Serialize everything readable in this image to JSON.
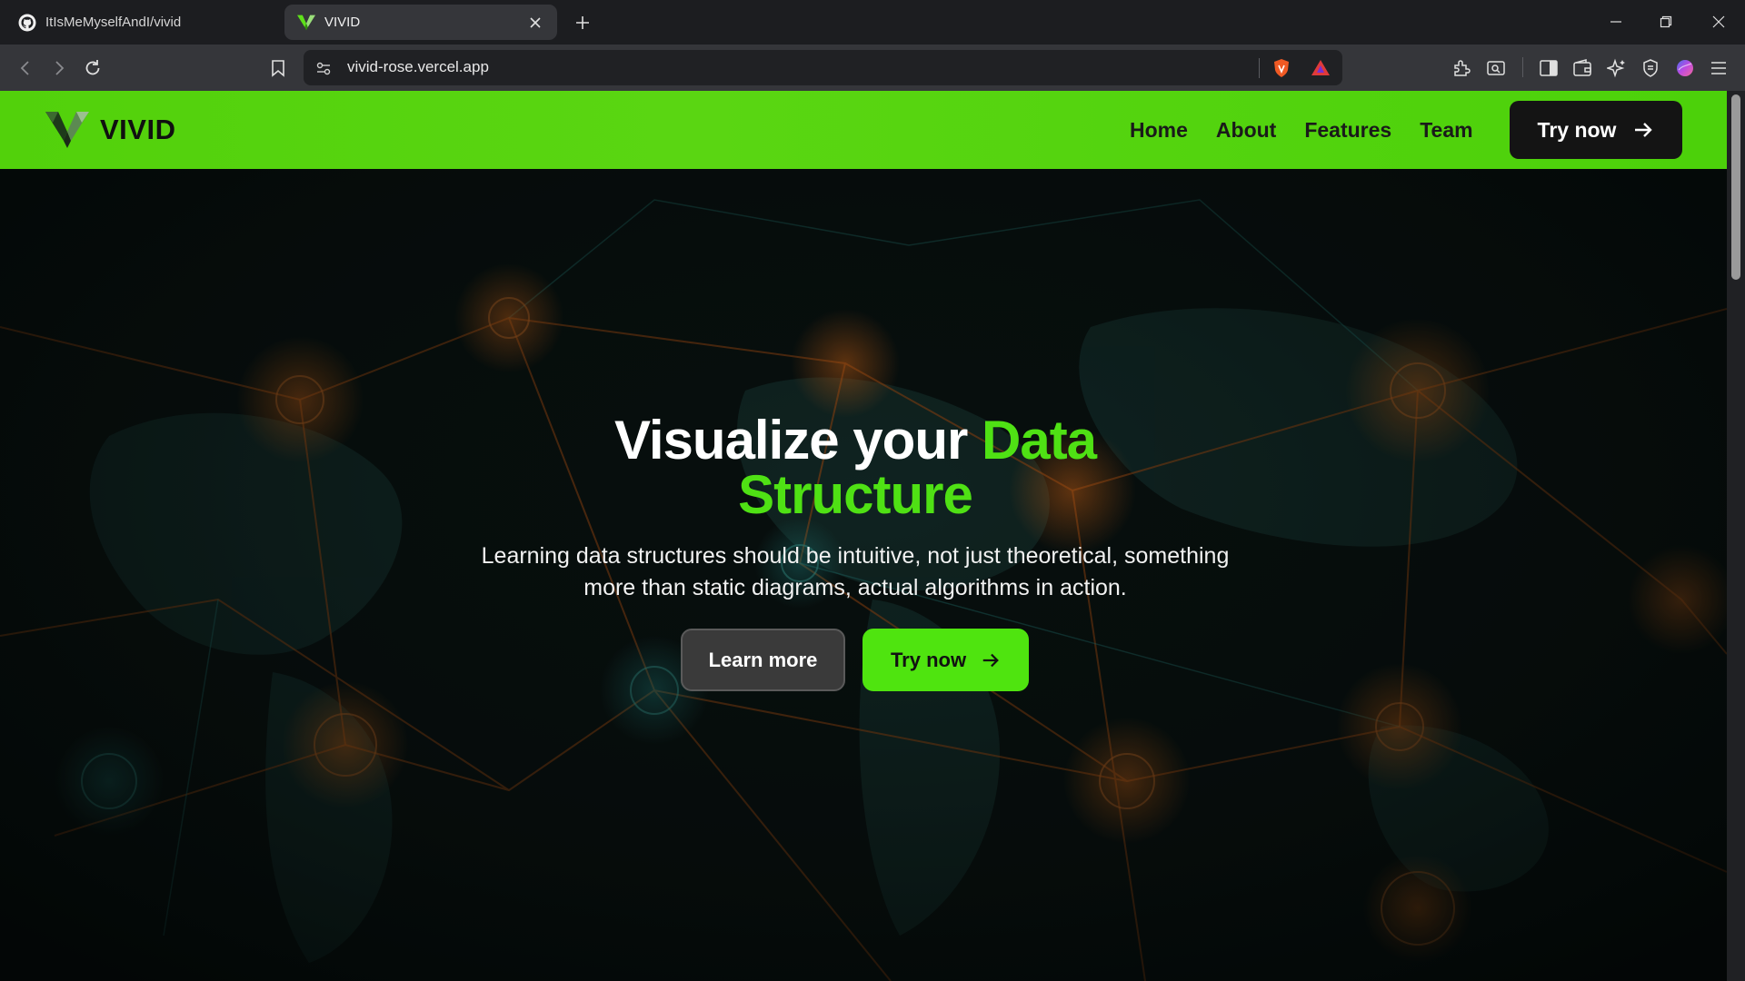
{
  "browser": {
    "tabs": [
      {
        "title": "ItIsMeMyselfAndI/vivid",
        "favicon": "github-icon",
        "active": false
      },
      {
        "title": "VIVID",
        "favicon": "vivid-logo-icon",
        "active": true
      }
    ],
    "address": "vivid-rose.vercel.app"
  },
  "site": {
    "brand": "VIVID",
    "nav": {
      "links": [
        "Home",
        "About",
        "Features",
        "Team"
      ],
      "cta_label": "Try now"
    },
    "hero": {
      "title_plain": "Visualize your ",
      "title_accent_1": "Data",
      "title_accent_2": "Structure",
      "subtitle": "Learning data structures should be intuitive, not just theoretical, something more than static diagrams, actual algorithms in action.",
      "learn_more_label": "Learn more",
      "try_now_label": "Try now"
    }
  },
  "colors": {
    "accent_green": "#4fe114",
    "nav_bar": "#52d10b",
    "dark_button": "#141414",
    "page_bg": "#070d0c"
  }
}
